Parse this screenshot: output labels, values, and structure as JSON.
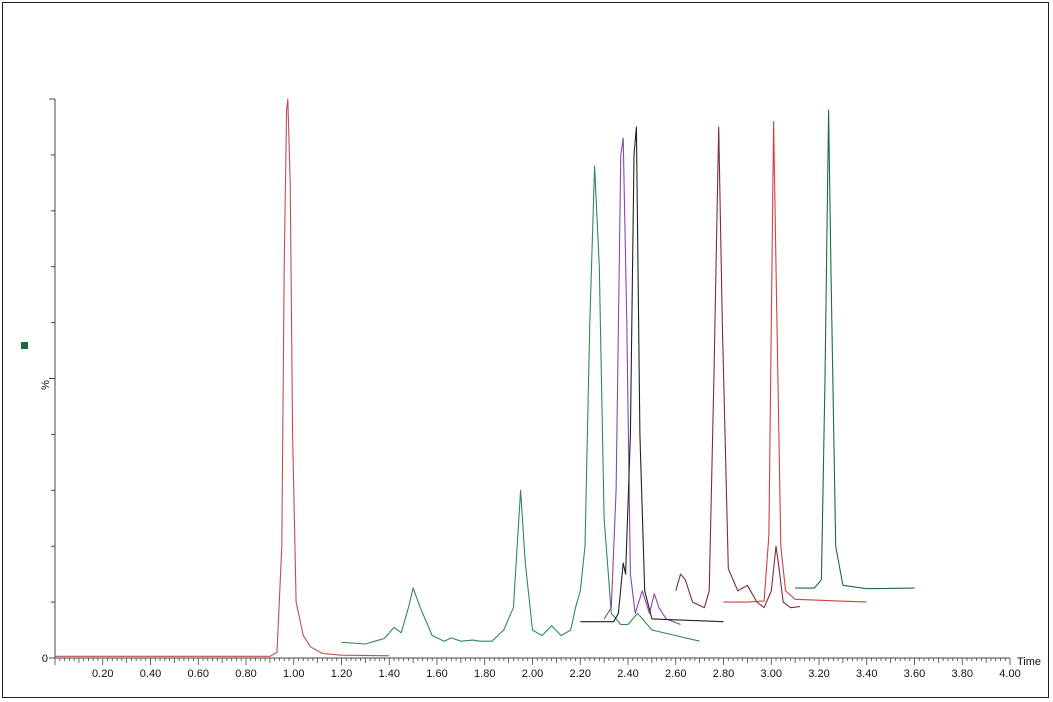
{
  "chart_data": {
    "type": "line",
    "title": "",
    "xlabel": "Time",
    "ylabel": "%",
    "xlim": [
      0.0,
      4.0
    ],
    "ylim": [
      0,
      100
    ],
    "y_tick_labels": [
      "0"
    ],
    "x_tick_labels": [
      "0.20",
      "0.40",
      "0.60",
      "0.80",
      "1.00",
      "1.20",
      "1.40",
      "1.60",
      "1.80",
      "2.00",
      "2.20",
      "2.40",
      "2.60",
      "2.80",
      "3.00",
      "3.20",
      "3.40",
      "3.60",
      "3.80",
      "4.00"
    ],
    "legend_marker_color": "#1a6b3c",
    "series": [
      {
        "color": "#c0504d",
        "points": [
          [
            0.0,
            0.3
          ],
          [
            0.5,
            0.3
          ],
          [
            0.9,
            0.3
          ],
          [
            0.93,
            1
          ],
          [
            0.95,
            20
          ],
          [
            0.96,
            70
          ],
          [
            0.97,
            98
          ],
          [
            0.975,
            100
          ],
          [
            0.985,
            85
          ],
          [
            0.995,
            40
          ],
          [
            1.01,
            10
          ],
          [
            1.02,
            8
          ],
          [
            1.04,
            4
          ],
          [
            1.07,
            2
          ],
          [
            1.12,
            0.8
          ],
          [
            1.2,
            0.5
          ],
          [
            1.4,
            0.4
          ]
        ]
      },
      {
        "color": "#2e8b57",
        "points": [
          [
            1.2,
            2.8
          ],
          [
            1.3,
            2.5
          ],
          [
            1.38,
            3.5
          ],
          [
            1.42,
            5.5
          ],
          [
            1.45,
            4.5
          ],
          [
            1.48,
            9
          ],
          [
            1.5,
            12.5
          ],
          [
            1.53,
            9
          ],
          [
            1.58,
            4
          ],
          [
            1.63,
            3
          ],
          [
            1.66,
            3.6
          ],
          [
            1.7,
            3
          ],
          [
            1.75,
            3.2
          ],
          [
            1.78,
            3
          ],
          [
            1.83,
            3
          ],
          [
            1.88,
            5
          ],
          [
            1.92,
            9
          ],
          [
            1.95,
            30
          ],
          [
            1.97,
            17
          ],
          [
            2.0,
            5
          ],
          [
            2.04,
            4
          ],
          [
            2.08,
            5.8
          ],
          [
            2.12,
            4
          ],
          [
            2.16,
            5
          ],
          [
            2.18,
            9
          ],
          [
            2.2,
            12
          ],
          [
            2.22,
            20
          ],
          [
            2.24,
            60
          ],
          [
            2.26,
            88
          ],
          [
            2.28,
            70
          ],
          [
            2.3,
            25
          ],
          [
            2.33,
            8
          ],
          [
            2.37,
            6
          ],
          [
            2.4,
            6
          ],
          [
            2.44,
            8
          ],
          [
            2.5,
            5
          ],
          [
            2.6,
            4
          ],
          [
            2.7,
            3
          ]
        ]
      },
      {
        "color": "#8e44ad",
        "points": [
          [
            2.3,
            7
          ],
          [
            2.33,
            9
          ],
          [
            2.35,
            30
          ],
          [
            2.37,
            90
          ],
          [
            2.38,
            93
          ],
          [
            2.395,
            60
          ],
          [
            2.41,
            15
          ],
          [
            2.43,
            8
          ],
          [
            2.46,
            12
          ],
          [
            2.49,
            8
          ],
          [
            2.51,
            11.5
          ],
          [
            2.53,
            9
          ],
          [
            2.56,
            7
          ],
          [
            2.62,
            6
          ]
        ]
      },
      {
        "color": "#222222",
        "points": [
          [
            2.2,
            6.5
          ],
          [
            2.34,
            6.5
          ],
          [
            2.36,
            8
          ],
          [
            2.38,
            17
          ],
          [
            2.39,
            15
          ],
          [
            2.41,
            40
          ],
          [
            2.425,
            90
          ],
          [
            2.435,
            95
          ],
          [
            2.45,
            40
          ],
          [
            2.47,
            12
          ],
          [
            2.5,
            7
          ],
          [
            2.8,
            6.5
          ]
        ]
      },
      {
        "color": "#7b2d43",
        "points": [
          [
            2.6,
            12
          ],
          [
            2.62,
            15
          ],
          [
            2.64,
            14
          ],
          [
            2.67,
            10
          ],
          [
            2.72,
            9
          ],
          [
            2.74,
            12
          ],
          [
            2.76,
            50
          ],
          [
            2.78,
            95
          ],
          [
            2.795,
            60
          ],
          [
            2.82,
            16
          ],
          [
            2.86,
            12
          ],
          [
            2.9,
            13
          ],
          [
            2.94,
            10
          ],
          [
            2.97,
            9
          ],
          [
            3.0,
            12
          ],
          [
            3.02,
            20
          ],
          [
            3.03,
            17
          ],
          [
            3.05,
            10
          ],
          [
            3.08,
            9
          ],
          [
            3.12,
            9.2
          ]
        ]
      },
      {
        "color": "#d43f3f",
        "points": [
          [
            2.8,
            10
          ],
          [
            2.9,
            10
          ],
          [
            2.97,
            10.2
          ],
          [
            2.99,
            22
          ],
          [
            3.01,
            96
          ],
          [
            3.02,
            70
          ],
          [
            3.04,
            20
          ],
          [
            3.06,
            12
          ],
          [
            3.1,
            10.5
          ],
          [
            3.4,
            10
          ]
        ]
      },
      {
        "color": "#1e6b44",
        "points": [
          [
            3.1,
            12.5
          ],
          [
            3.18,
            12.5
          ],
          [
            3.21,
            14
          ],
          [
            3.225,
            50
          ],
          [
            3.24,
            98
          ],
          [
            3.25,
            70
          ],
          [
            3.27,
            20
          ],
          [
            3.3,
            13
          ],
          [
            3.4,
            12.4
          ],
          [
            3.6,
            12.5
          ]
        ]
      }
    ]
  }
}
